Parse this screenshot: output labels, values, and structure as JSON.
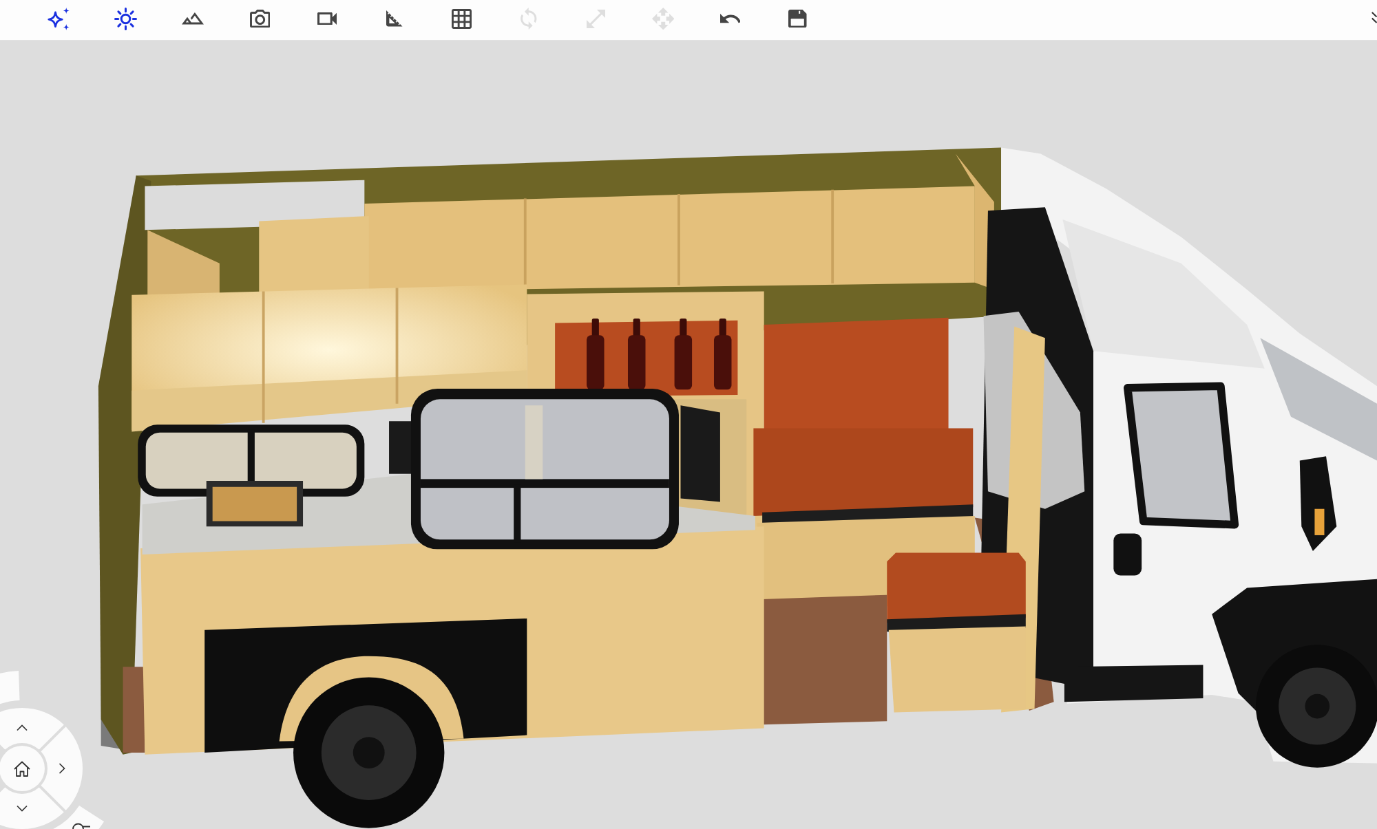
{
  "toolbar": {
    "buttons": [
      {
        "on": true,
        "disabled": false
      },
      {
        "on": true,
        "disabled": false
      },
      {
        "on": false,
        "disabled": false
      },
      {
        "on": false,
        "disabled": false
      },
      {
        "on": false,
        "disabled": false
      },
      {
        "on": false,
        "disabled": false
      },
      {
        "on": false,
        "disabled": false
      },
      {
        "on": false,
        "disabled": true
      },
      {
        "on": false,
        "disabled": true
      },
      {
        "on": false,
        "disabled": true
      },
      {
        "on": false,
        "disabled": false
      },
      {
        "on": false,
        "disabled": false
      }
    ]
  }
}
